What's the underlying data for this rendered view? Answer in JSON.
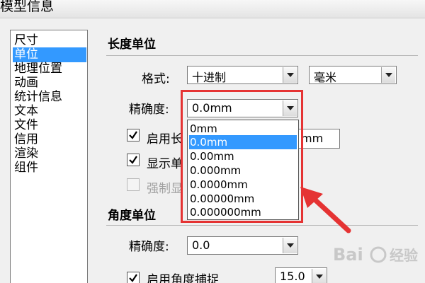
{
  "window": {
    "title": "模型信息"
  },
  "sidebar": {
    "items": [
      {
        "label": "尺寸"
      },
      {
        "label": "单位"
      },
      {
        "label": "地理位置"
      },
      {
        "label": "动画"
      },
      {
        "label": "统计信息"
      },
      {
        "label": "文本"
      },
      {
        "label": "文件"
      },
      {
        "label": "信用"
      },
      {
        "label": "渲染"
      },
      {
        "label": "组件"
      }
    ],
    "selected_index": 1
  },
  "length_unit": {
    "section_title": "长度单位",
    "format_label": "格式:",
    "format_value": "十进制",
    "unit_value": "毫米",
    "precision_label": "精确度:",
    "precision_value": "0.0mm",
    "precision_options": [
      "0mm",
      "0.0mm",
      "0.00mm",
      "0.000mm",
      "0.0000mm",
      "0.00000mm",
      "0.000000mm"
    ],
    "precision_selected_index": 1,
    "enable_snap_label": "启用长",
    "snap_value": "mm",
    "show_unit_label": "显示单",
    "force_label": "强制显"
  },
  "angle_unit": {
    "section_title": "角度单位",
    "precision_label": "精确度:",
    "precision_value": "0.0",
    "enable_snap_label": "启用角度捕捉",
    "snap_value": "15.0"
  },
  "colors": {
    "selection": "#3399ff",
    "highlight_red": "#e53333"
  }
}
